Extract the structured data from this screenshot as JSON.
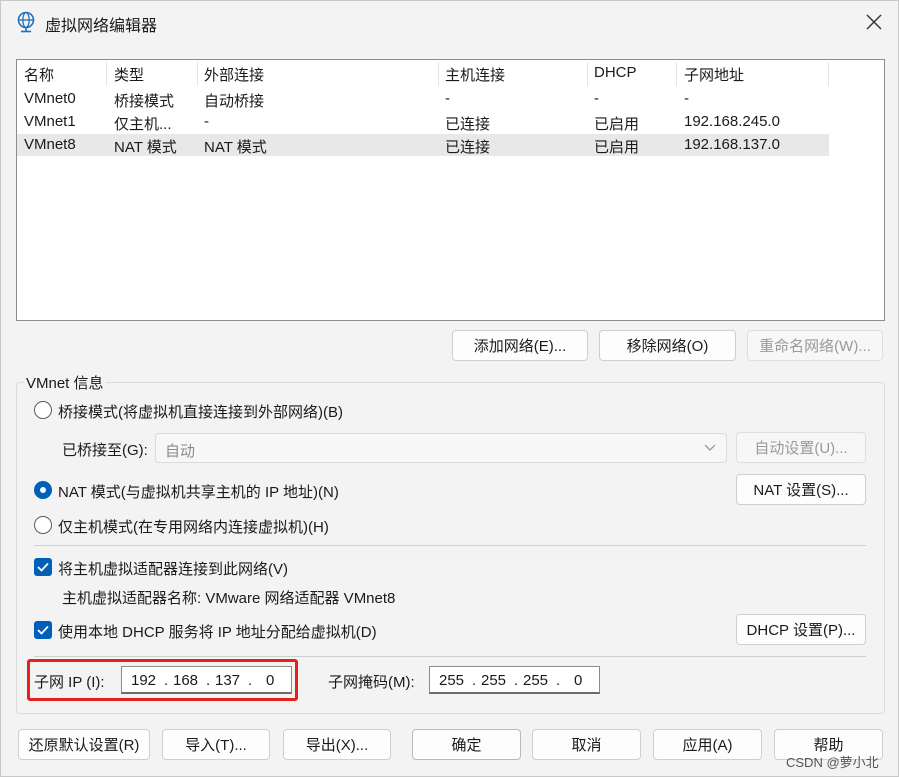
{
  "window": {
    "title": "虚拟网络编辑器",
    "icon": "globe-icon",
    "close_icon": "close-icon"
  },
  "network_table": {
    "headers": [
      "名称",
      "类型",
      "外部连接",
      "主机连接",
      "DHCP",
      "子网地址"
    ],
    "rows": [
      [
        "VMnet0",
        "桥接模式",
        "自动桥接",
        "-",
        "-",
        "-"
      ],
      [
        "VMnet1",
        "仅主机...",
        "-",
        "已连接",
        "已启用",
        "192.168.245.0"
      ],
      [
        "VMnet8",
        "NAT 模式",
        "NAT 模式",
        "已连接",
        "已启用",
        "192.168.137.0"
      ]
    ],
    "selected_row": 2
  },
  "list_buttons": {
    "add": "添加网络(E)...",
    "remove": "移除网络(O)",
    "rename": "重命名网络(W)..."
  },
  "vmnet_info": {
    "title": "VMnet 信息",
    "bridged_label": "桥接模式(将虚拟机直接连接到外部网络)(B)",
    "bridged_to_label": "已桥接至(G):",
    "bridged_to_value": "自动",
    "auto_settings": "自动设置(U)...",
    "nat_label": "NAT 模式(与虚拟机共享主机的 IP 地址)(N)",
    "nat_settings": "NAT 设置(S)...",
    "host_only_label": "仅主机模式(在专用网络内连接虚拟机)(H)",
    "selected_mode": "nat",
    "connect_adapter_label": "将主机虚拟适配器连接到此网络(V)",
    "connect_adapter_checked": true,
    "adapter_name_text": "主机虚拟适配器名称: VMware 网络适配器 VMnet8",
    "dhcp_label": "使用本地 DHCP 服务将 IP 地址分配给虚拟机(D)",
    "dhcp_checked": true,
    "dhcp_settings": "DHCP 设置(P)...",
    "subnet_ip_label": "子网 IP (I):",
    "subnet_ip": [
      "192",
      "168",
      "137",
      "0"
    ],
    "subnet_mask_label": "子网掩码(M):",
    "subnet_mask": [
      "255",
      "255",
      "255",
      "0"
    ],
    "highlight_color": "#e8201d"
  },
  "footer_buttons": {
    "restore": "还原默认设置(R)",
    "import": "导入(T)...",
    "export": "导出(X)...",
    "ok": "确定",
    "cancel": "取消",
    "apply": "应用(A)",
    "help": "帮助"
  },
  "watermark": "CSDN @萝小北",
  "colors": {
    "accent": "#005fb8",
    "window_bg": "#f3f3f3",
    "selected_row": "#e8e8e8"
  }
}
